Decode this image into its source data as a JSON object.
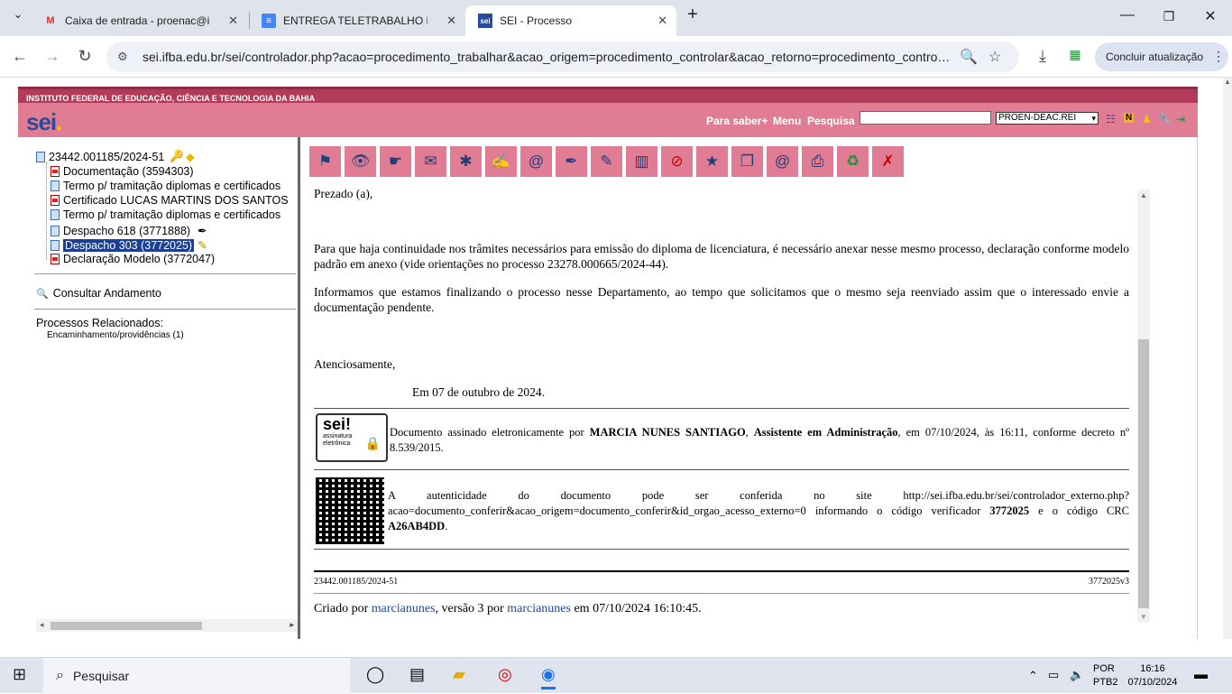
{
  "browser": {
    "tabs": [
      {
        "title": "Caixa de entrada - proenac@ifba.e",
        "favicon": "gmail-icon"
      },
      {
        "title": "ENTREGA TELETRABALHO MARC",
        "favicon": "docs-icon"
      },
      {
        "title": "SEI - Processo",
        "favicon": "sei-icon"
      }
    ],
    "url": "sei.ifba.edu.br/sei/controlador.php?acao=procedimento_trabalhar&acao_origem=procedimento_controlar&acao_retorno=procedimento_contro…",
    "update_button": "Concluir atualização"
  },
  "sei": {
    "institution": "INSTITUTO FEDERAL DE EDUCAÇÃO, CIÊNCIA E TECNOLOGIA DA BAHIA",
    "logo": "sei",
    "links": {
      "para_saber": "Para saber+",
      "menu": "Menu",
      "pesquisa": "Pesquisa"
    },
    "unit": "PROEN-DEAC.REI"
  },
  "tree": {
    "process": "23442.001185/2024-51",
    "items": [
      {
        "label": "Documentação (3594303)",
        "type": "pdf"
      },
      {
        "label": "Termo p/ tramitação diplomas e certificados",
        "type": "doc"
      },
      {
        "label": "Certificado LUCAS MARTINS DOS SANTOS",
        "type": "pdf"
      },
      {
        "label": "Termo p/ tramitação diplomas e certificados",
        "type": "doc"
      },
      {
        "label": "Despacho 618 (3771888)",
        "type": "doc"
      },
      {
        "label": "Despacho 303 (3772025)",
        "type": "doc"
      },
      {
        "label": "Declaração Modelo (3772047)",
        "type": "pdf"
      }
    ],
    "consultar": "Consultar Andamento",
    "related_title": "Processos Relacionados:",
    "related_item": "Encaminhamento/providências (1)"
  },
  "document": {
    "greeting": "Prezado (a),",
    "para1": "Para que haja continuidade nos trâmites necessários para emissão do diploma de licenciatura, é necessário anexar nesse mesmo processo, declaração conforme modelo padrão em anexo (vide orientações no processo 23278.000665/2024-44).",
    "para2": "Informamos que estamos finalizando o processo nesse Departamento, ao tempo que solicitamos que o mesmo seja reenviado assim que o interessado envie a documentação pendente.",
    "closing": "Atenciosamente,",
    "date_line": "Em 07 de outubro de 2024.",
    "sig_prefix": "Documento assinado eletronicamente por",
    "sig_name": "MARCIA NUNES SANTIAGO",
    "sig_role": "Assistente em Administração",
    "sig_suffix": ", em 07/10/2024, às 16:11, conforme decreto nº 8.539/2015.",
    "seal_top": "sei!",
    "seal_bottom": "assinatura eletrônica",
    "auth_text": "A autenticidade do documento pode ser conferida no site http://sei.ifba.edu.br/sei/controlador_externo.php?acao=documento_conferir&acao_origem=documento_conferir&id_orgao_acesso_externo=0 informando o código verificador",
    "auth_code": "3772025",
    "auth_mid": "e o código CRC",
    "auth_crc": "A26AB4DD",
    "footer_left": "23442.001185/2024-51",
    "footer_right": "3772025v3",
    "created_by_prefix": "Criado por",
    "created_by_user": "marcianunes",
    "created_by_mid": ", versão 3 por",
    "created_by_user2": "marcianunes",
    "created_by_suffix": "em 07/10/2024 16:10:45."
  },
  "taskbar": {
    "search": "Pesquisar",
    "lang": "POR",
    "layout": "PTB2",
    "time": "16:16",
    "date": "07/10/2024"
  }
}
